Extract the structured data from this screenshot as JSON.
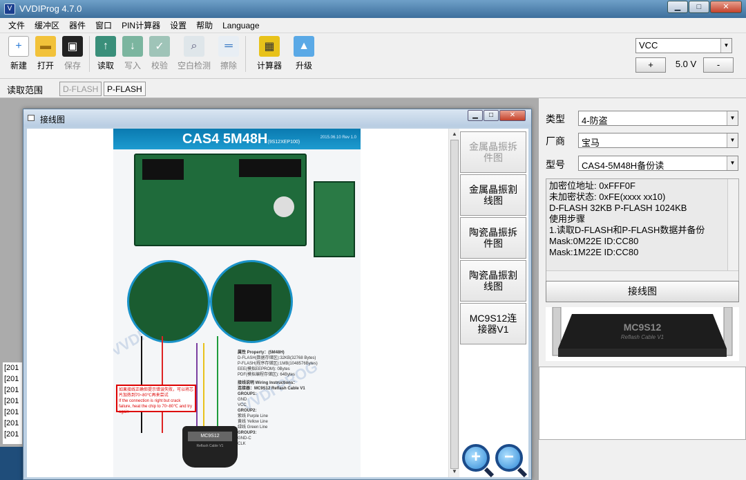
{
  "window": {
    "title": "VVDIProg 4.7.0",
    "min": "▁",
    "max": "□",
    "close": "✕"
  },
  "menu": [
    "文件",
    "缓冲区",
    "器件",
    "窗口",
    "PIN计算器",
    "设置",
    "帮助",
    "Language"
  ],
  "toolbar": {
    "new": "新建",
    "open": "打开",
    "save": "保存",
    "read": "读取",
    "write": "写入",
    "verify": "校验",
    "blank": "空白检测",
    "erase": "擦除",
    "calc": "计算器",
    "upgrade": "升级"
  },
  "vcc": {
    "select": "VCC",
    "plus": "+",
    "value": "5.0 V",
    "minus": "-"
  },
  "range": {
    "label": "读取范围",
    "dflash": "D-FLASH",
    "pflash": "P-FLASH"
  },
  "log_left": [
    "[201",
    "[201",
    "[201",
    "[201",
    "[201",
    "[201",
    "[201"
  ],
  "right": {
    "type_label": "类型",
    "type_value": "4-防盗",
    "vendor_label": "厂商",
    "vendor_value": "宝马",
    "model_label": "型号",
    "model_value": "CAS4-5M48H备份读",
    "info": [
      "加密位地址: 0xFFF0F",
      "未加密状态: 0xFE(xxxx xx10)",
      "D-FLASH 32KB P-FLASH 1024KB",
      "使用步骤",
      "1.读取D-FLASH和P-FLASH数据并备份",
      "Mask:0M22E ID:CC80",
      "Mask:1M22E ID:CC80"
    ],
    "wiring_btn": "接线图",
    "cable_label": "MC9S12",
    "cable_sub": "Reflash Cable V1"
  },
  "dialog": {
    "title": "接线图",
    "side": [
      "金属晶振拆件图",
      "金属晶振割线图",
      "陶瓷晶振拆件图",
      "陶瓷晶振割线图",
      "MC9S12连接器V1"
    ],
    "zoom_in": "+",
    "zoom_out": "−"
  },
  "diagram": {
    "title": "CAS4  5M48H",
    "title_sub": "(9S12XEP100)",
    "date": "2015.06.10 Rev 1.0",
    "watermark": "VVDI PROG",
    "red_box": "如果接线正确但提示错误失败，可以将芯片加热到70~80℃再来尝试",
    "red_box_en": "If the connection is right but crack failure, heat the chip to 70~80℃ and try again",
    "connector": "MC9S12",
    "connector_sub": "Reflash Cable V1",
    "props": [
      "属性 Property：(5M48H)",
      "D-FLASH(数据存储区):32KB(32768 Bytes)",
      "P-FLASH(程序存储区):1MB(1048576Bytes)",
      "EEE(模拟EEPROM):  0Bytes",
      "PDF(模拟编程存储区): 64Bytes",
      "接线说明 Wiring Instructions：",
      "连接器：MC9S12 Reflash Cable V1",
      "GROUP1:",
      "GND",
      "VCC",
      "GROUP2:",
      "紫线 Purple Line",
      "黄线 Yellow Line",
      "绿线 Green Line",
      "GROUP3:",
      "GND-C",
      "CLK"
    ]
  }
}
